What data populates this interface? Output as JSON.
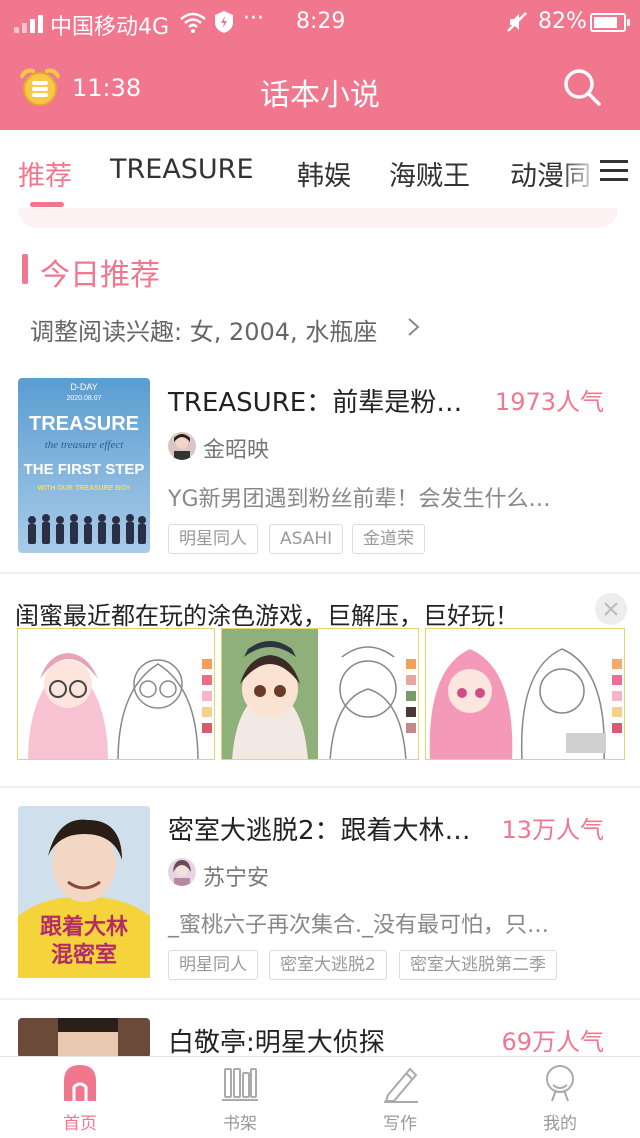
{
  "status_bar": {
    "carrier": "中国移动4G",
    "dots": "···",
    "time": "8:29",
    "battery": "82%",
    "battery_level": 0.82
  },
  "app_bar": {
    "timer": "11:38",
    "title": "话本小说"
  },
  "tabs": [
    {
      "label": "推荐",
      "active": true
    },
    {
      "label": "TREASURE"
    },
    {
      "label": "韩娱"
    },
    {
      "label": "海贼王"
    },
    {
      "label": "动漫同"
    }
  ],
  "section": {
    "title": "今日推荐",
    "interest": "调整阅读兴趣: 女, 2004, 水瓶座"
  },
  "books": [
    {
      "title": "TREASURE：前辈是粉…",
      "popularity": "1973人气",
      "author": "金昭映",
      "desc": "YG新男团遇到粉丝前辈！会发生什么…",
      "tags": [
        "明星同人",
        "ASAHI",
        "金道荣"
      ],
      "cover": {
        "top": "D-DAY",
        "date": "2020.08.07",
        "big1": "TREASURE",
        "big2": "THE FIRST STEP",
        "sub": "WITH OUR TREASURE BOY",
        "script": "the treasure effect"
      }
    },
    {
      "title": "密室大逃脱2：跟着大林…",
      "popularity": "13万人气",
      "author": "苏宁安",
      "desc": "_蜜桃六子再次集合._没有最可怕，只…",
      "tags": [
        "明星同人",
        "密室大逃脱2",
        "密室大逃脱第二季"
      ],
      "cover": {
        "line1": "跟着大林",
        "line2": "混密室"
      }
    },
    {
      "title": "白敬亭:明星大侦探",
      "popularity": "69万人气"
    }
  ],
  "ad": {
    "title": "闺蜜最近都在玩的涂色游戏，巨解压，巨好玩！"
  },
  "bottom_nav": [
    {
      "label": "首页",
      "icon": "home-icon",
      "active": true
    },
    {
      "label": "书架",
      "icon": "bookshelf-icon"
    },
    {
      "label": "写作",
      "icon": "pen-icon"
    },
    {
      "label": "我的",
      "icon": "profile-icon"
    }
  ],
  "colors": {
    "brand": "#f1778f",
    "text": "#333333",
    "muted": "#999999"
  }
}
